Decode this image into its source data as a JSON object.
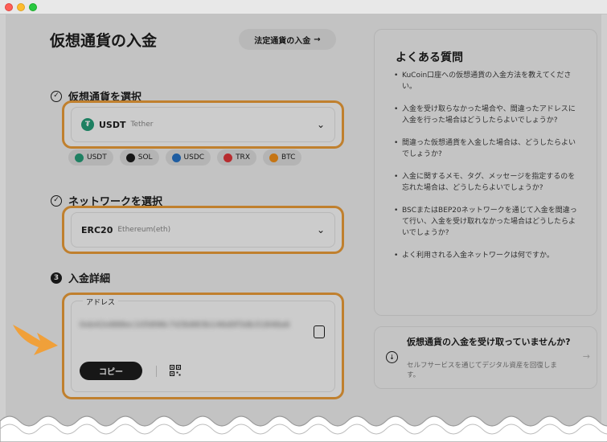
{
  "page": {
    "title": "仮想通貨の入金",
    "fiat_button": "法定通貨の入金",
    "fiat_arrow": "→"
  },
  "step1": {
    "label": "仮想通貨を選択",
    "selected_symbol": "USDT",
    "selected_name": "Tether",
    "coin_icon_glyph": "₮",
    "chevron": "⌄",
    "chips": [
      {
        "label": "USDT",
        "color": "#26a17b"
      },
      {
        "label": "SOL",
        "color": "#1d1d1d"
      },
      {
        "label": "USDC",
        "color": "#2775ca"
      },
      {
        "label": "TRX",
        "color": "#e5383b"
      },
      {
        "label": "BTC",
        "color": "#f7931a"
      }
    ]
  },
  "step2": {
    "label": "ネットワークを選択",
    "selected_network": "ERC20",
    "selected_network_name": "Ethereum(eth)",
    "chevron": "⌄"
  },
  "step3": {
    "number": "3",
    "label": "入金詳細",
    "address_label": "アドレス",
    "address_value": "0xb42e888ec105898c7d3b883b146d0f3db31848a6",
    "copy_button": "コピー"
  },
  "faq": {
    "title": "よくある質問",
    "items": [
      "KuCoin口座への仮想通貨の入金方法を教えてください。",
      "入金を受け取らなかった場合や、間違ったアドレスに入金を行った場合はどうしたらよいでしょうか?",
      "間違った仮想通貨を入金した場合は、どうしたらよいでしょうか?",
      "入金に関するメモ、タグ、メッセージを指定するのを忘れた場合は、どうしたらよいでしょうか?",
      "BSCまたはBEP20ネットワークを通じて入金を間違って行い、入金を受け取れなかった場合はどうしたらよいでしょうか?",
      "よく利用される入金ネットワークは何ですか。"
    ]
  },
  "not_received": {
    "title": "仮想通貨の入金を受け取っていませんか?",
    "description": "セルフサービスを通じてデジタル資産を回復します。",
    "arrow": "→",
    "icon_glyph": "↓"
  },
  "colors": {
    "highlight": "#f0a03a",
    "pointer_arrow": "#f0a03a",
    "traffic_red": "#fe5f57",
    "traffic_yellow": "#febc2e",
    "traffic_green": "#28c840"
  }
}
